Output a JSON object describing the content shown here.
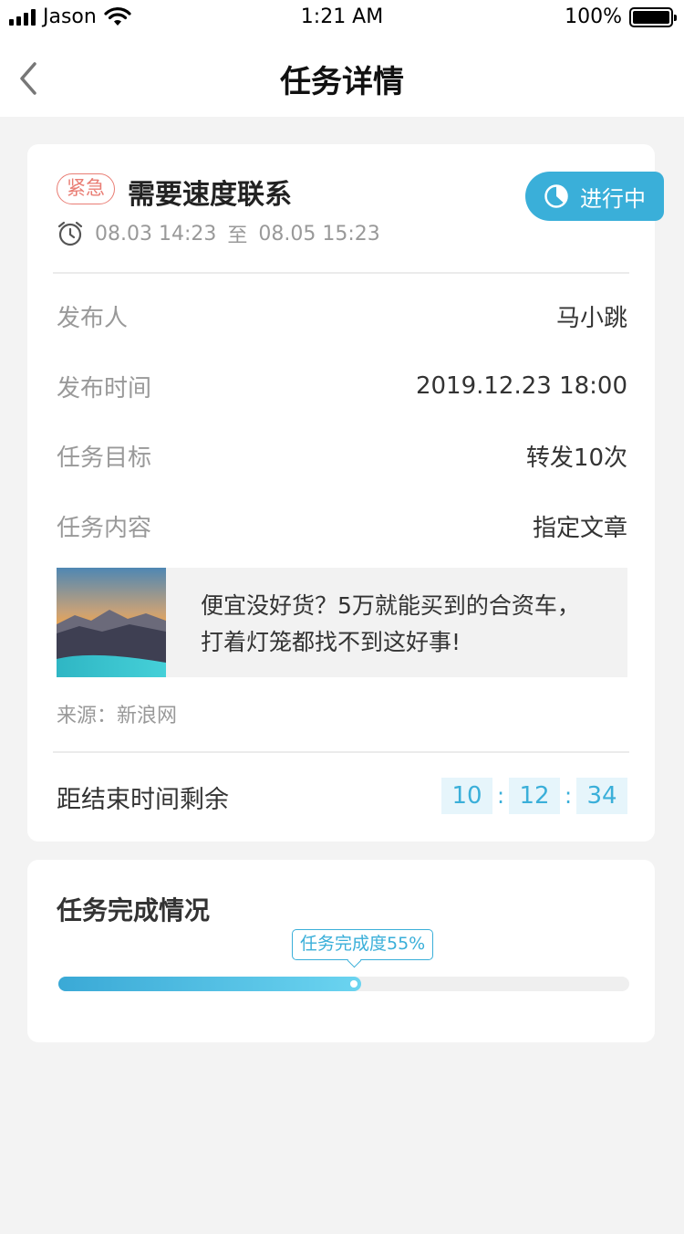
{
  "status_bar": {
    "carrier": "Jason",
    "time": "1:21 AM",
    "battery": "100%"
  },
  "nav": {
    "title": "任务详情"
  },
  "task": {
    "tag": "紧急",
    "title": "需要速度联系",
    "status": "进行中",
    "time_start": "08.03 14:23",
    "time_to": "至",
    "time_end": "08.05 15:23"
  },
  "details": [
    {
      "label": "发布人",
      "value": "马小跳"
    },
    {
      "label": "发布时间",
      "value": "2019.12.23 18:00"
    },
    {
      "label": "任务目标",
      "value": "转发10次"
    },
    {
      "label": "任务内容",
      "value": "指定文章"
    }
  ],
  "article": {
    "title_line1": "便宜没好货？5万就能买到的合资车，",
    "title_line2": "打着灯笼都找不到这好事!",
    "source": "来源：新浪网"
  },
  "countdown": {
    "label": "距结束时间剩余",
    "hours": "10",
    "minutes": "12",
    "seconds": "34",
    "separator": ":"
  },
  "completion": {
    "title": "任务完成情况",
    "tooltip": "任务完成度55%",
    "percent": 55
  },
  "colors": {
    "accent": "#3aafd9",
    "urgent": "#e97d74"
  }
}
